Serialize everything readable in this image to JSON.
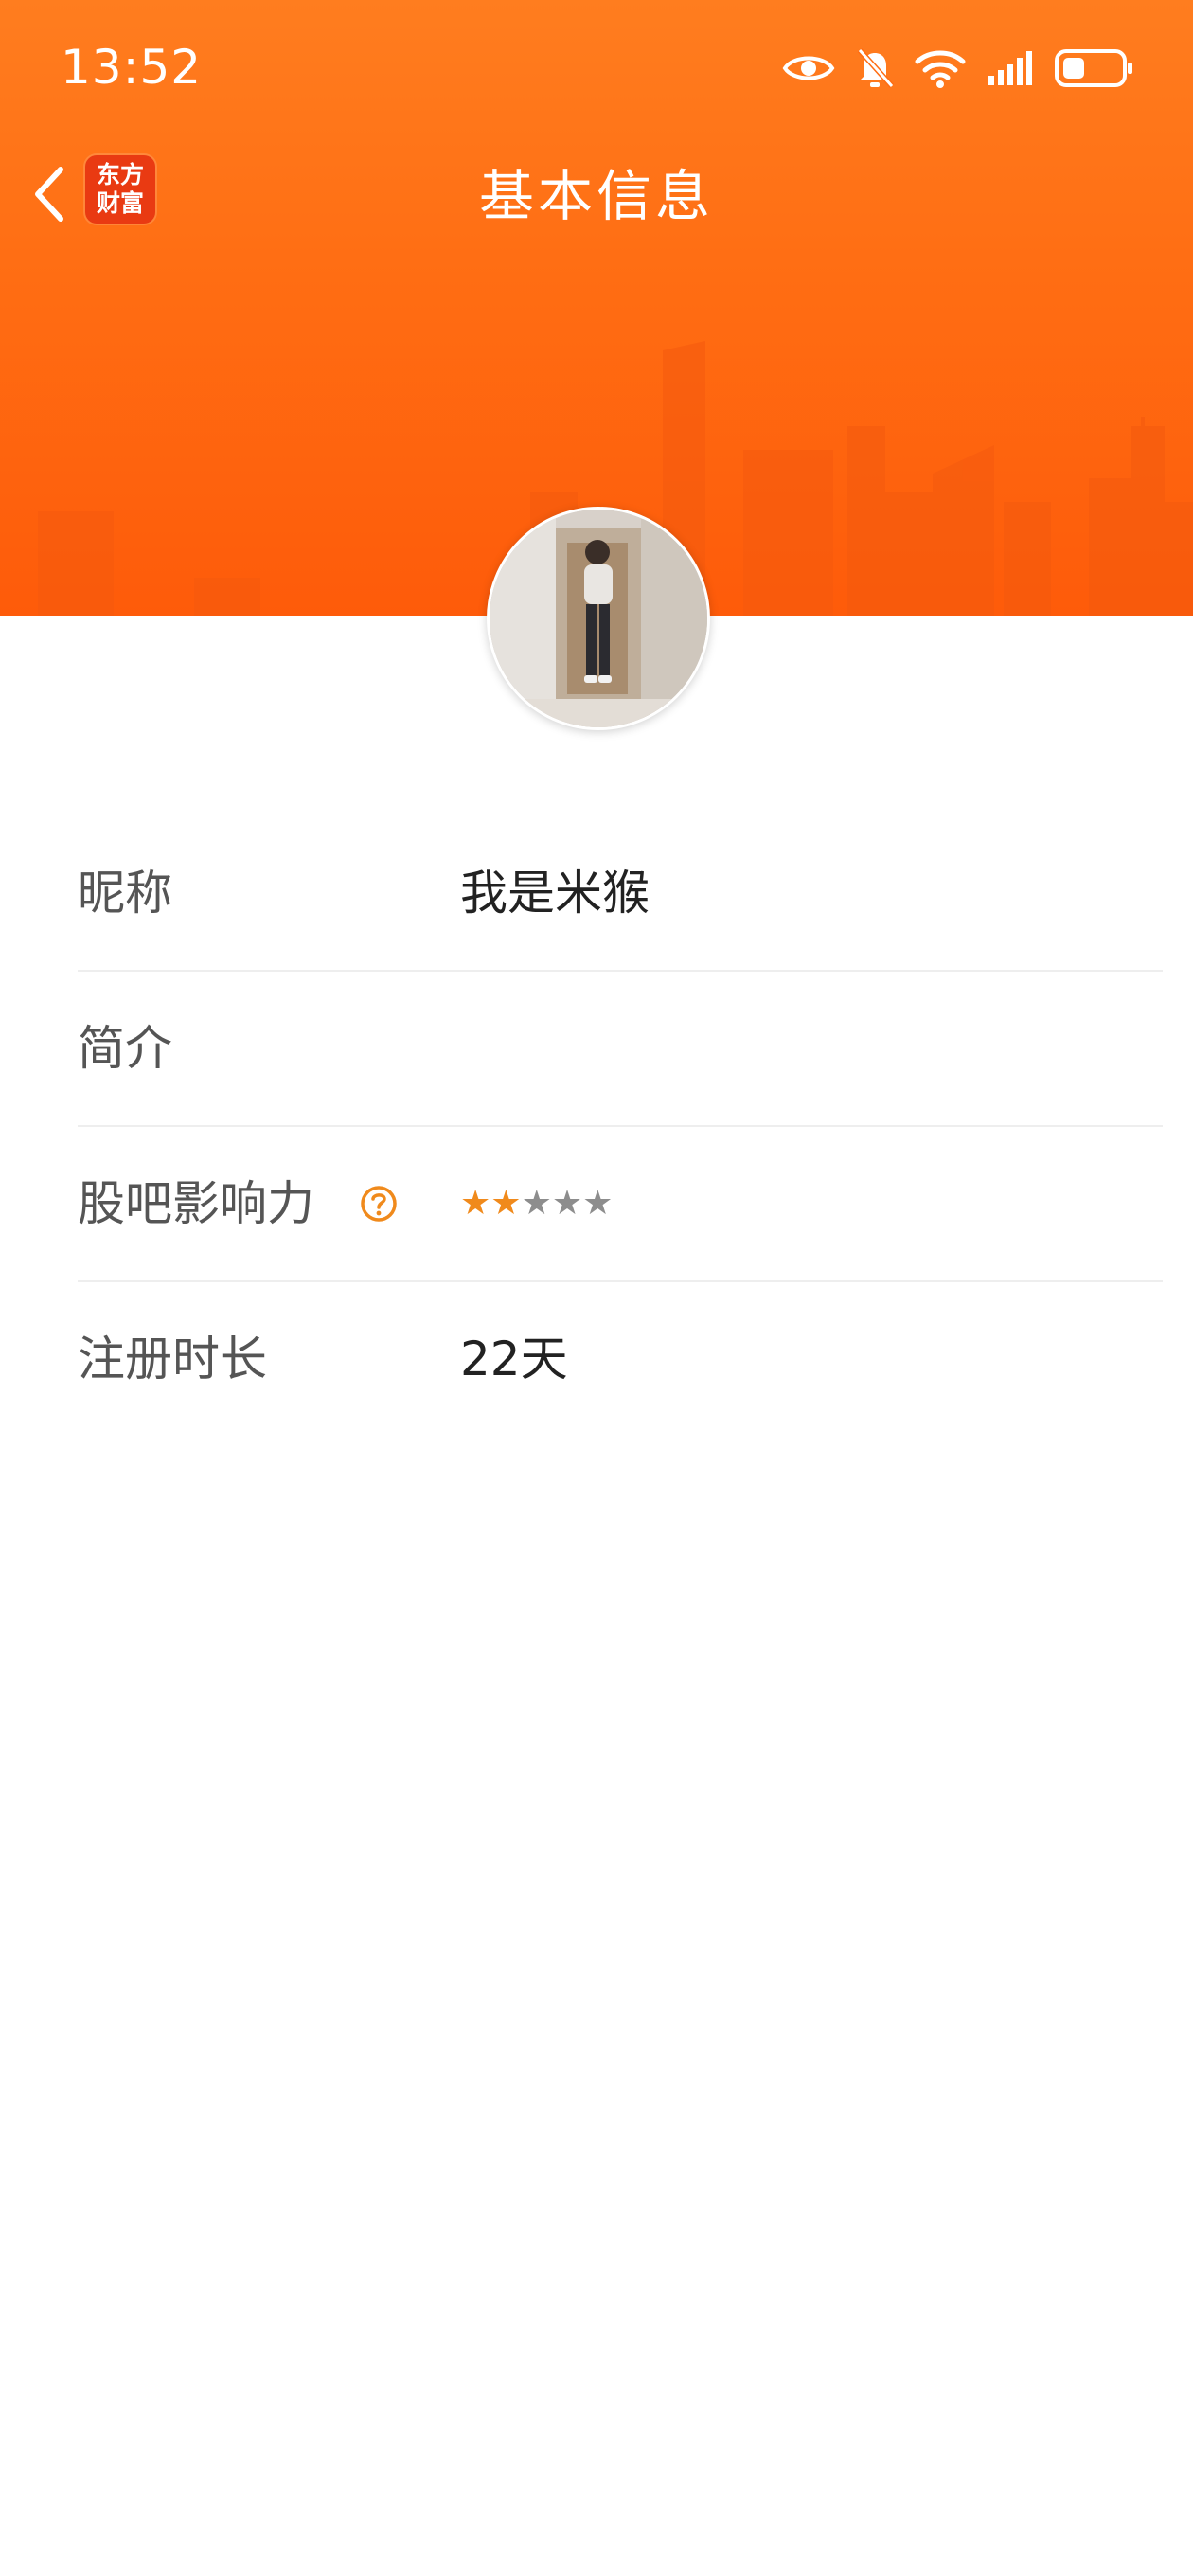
{
  "status_bar": {
    "time": "13:52",
    "icons": [
      "eye-icon",
      "bell-muted-icon",
      "wifi-icon",
      "signal-icon",
      "battery-icon"
    ],
    "battery_level": 0.3
  },
  "nav": {
    "back_icon": "chevron-left-icon",
    "logo_line1": "东方",
    "logo_line2": "财富",
    "title": "基本信息"
  },
  "profile": {
    "rows": [
      {
        "label": "昵称",
        "value": "我是米猴"
      },
      {
        "label": "简介",
        "value": ""
      },
      {
        "label": "股吧影响力",
        "stars_filled": 2,
        "stars_total": 5,
        "help_icon": "question-circle-icon"
      },
      {
        "label": "注册时长",
        "value": "22天"
      }
    ]
  },
  "colors": {
    "header_orange": "#ff6d13",
    "accent_star": "#f08a1c",
    "logo_red": "#e93a12"
  }
}
